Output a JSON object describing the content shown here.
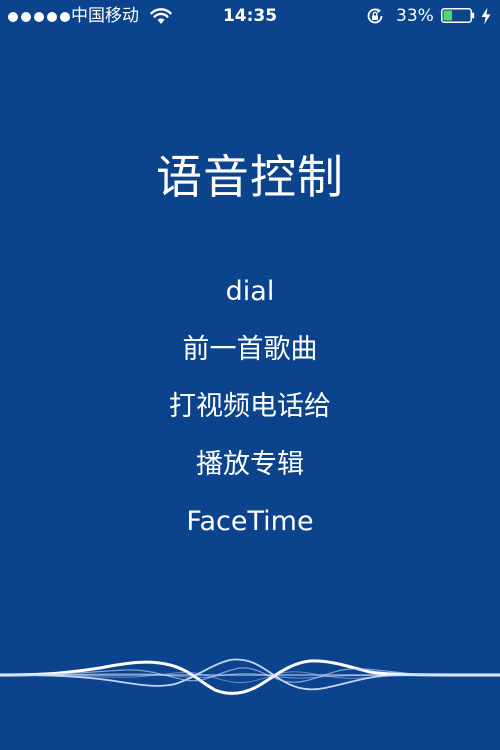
{
  "status_bar": {
    "carrier": "中国移动",
    "time": "14:35",
    "battery_percent": "33%",
    "battery_level": 0.33,
    "signal_bars": 5,
    "icons": [
      "signal-dots-icon",
      "wifi-icon",
      "rotation-lock-icon",
      "battery-icon",
      "charging-bolt-icon"
    ]
  },
  "title": "语音控制",
  "commands": [
    "dial",
    "前一首歌曲",
    "打视频电话给",
    "播放专辑",
    "FaceTime"
  ],
  "colors": {
    "background": "#0B438D",
    "text": "#FFFFFF",
    "battery_fill": "#4CD964"
  }
}
